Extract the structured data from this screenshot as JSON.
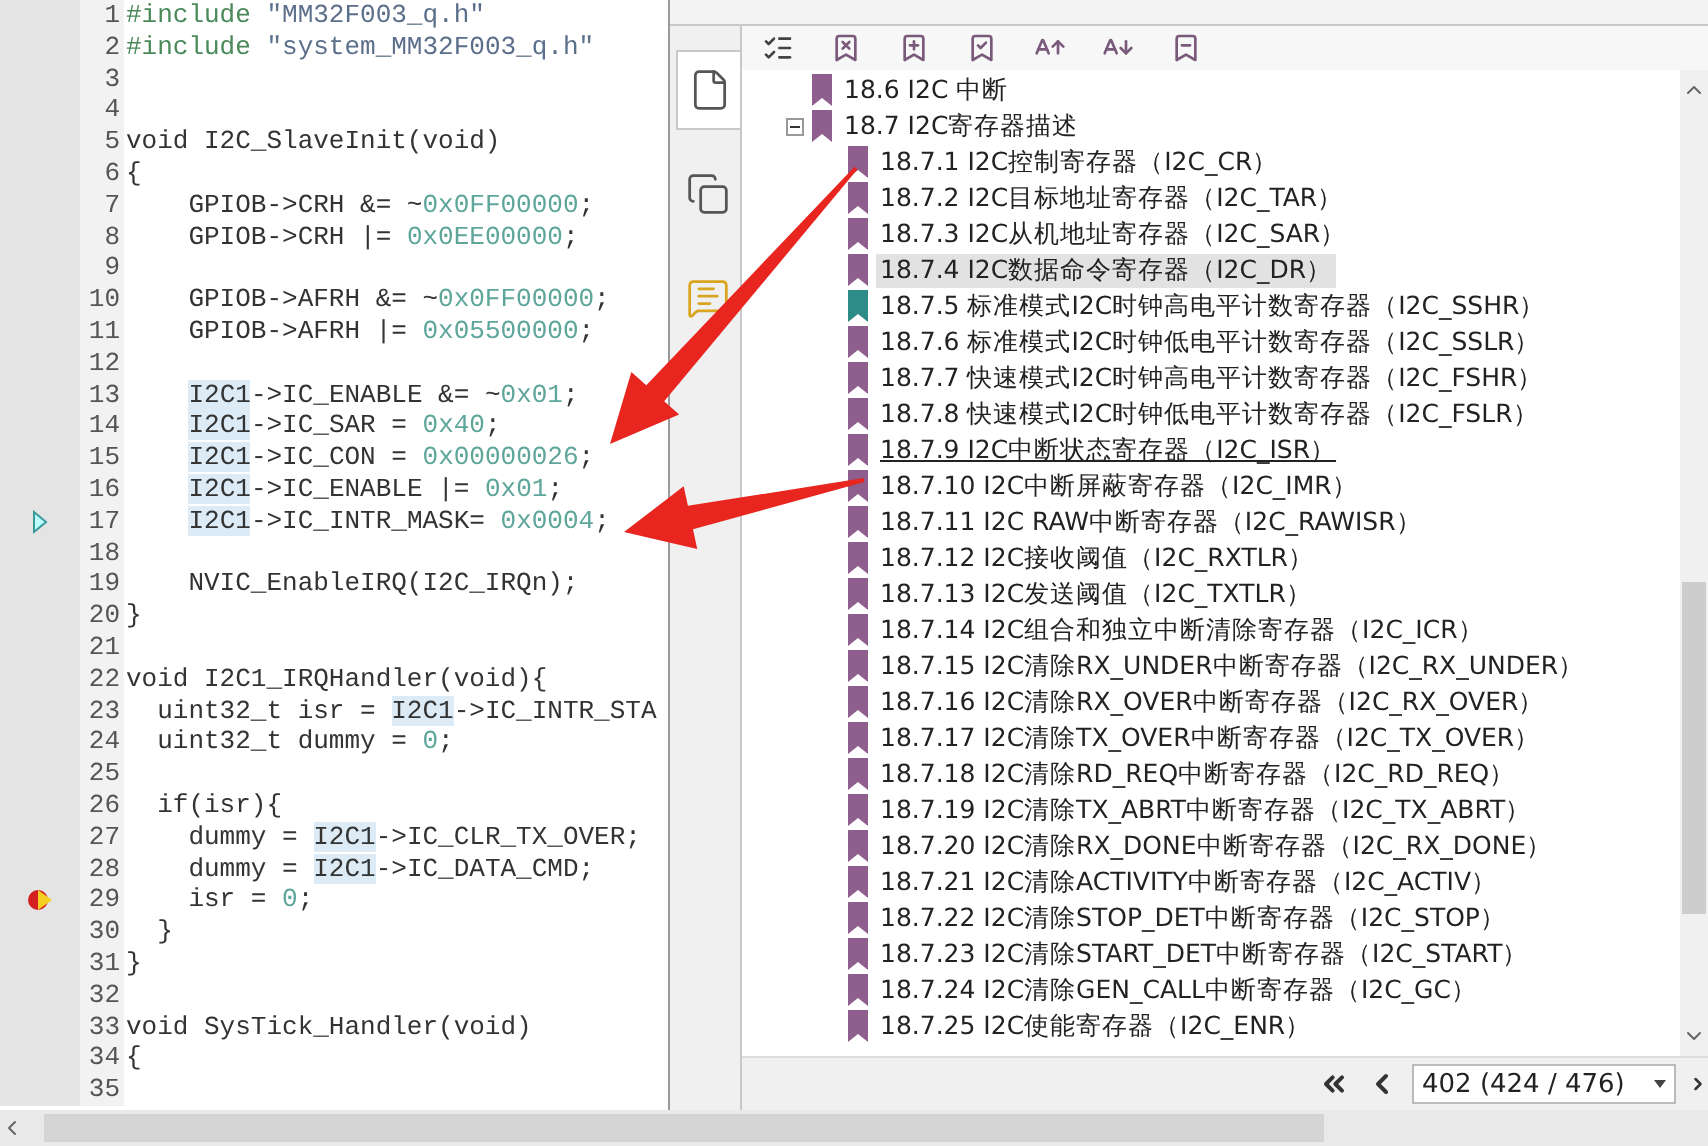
{
  "editor": {
    "lines": [
      {
        "number": "1",
        "current": false,
        "breakpoint": false,
        "segments": [
          {
            "kind": "pre",
            "text": "#include"
          },
          {
            "kind": "str",
            "text": " \"MM32F003_q.h\""
          }
        ]
      },
      {
        "number": "2",
        "current": false,
        "breakpoint": false,
        "segments": [
          {
            "kind": "pre",
            "text": "#include"
          },
          {
            "kind": "str",
            "text": " \"system_MM32F003_q.h\""
          }
        ]
      },
      {
        "number": "3",
        "current": false,
        "breakpoint": false
      },
      {
        "number": "4",
        "current": false,
        "breakpoint": false
      },
      {
        "number": "5",
        "current": false,
        "breakpoint": false,
        "segments": [
          {
            "kind": "text",
            "text": "void I2C_SlaveInit(void)"
          }
        ]
      },
      {
        "number": "6",
        "current": false,
        "breakpoint": false,
        "segments": [
          {
            "kind": "text",
            "text": "{"
          }
        ]
      },
      {
        "number": "7",
        "current": false,
        "breakpoint": false,
        "segments": [
          {
            "kind": "text",
            "text": "    GPIOB->CRH &= ~"
          },
          {
            "kind": "num",
            "text": "0x0FF00000"
          },
          {
            "kind": "text",
            "text": ";"
          }
        ]
      },
      {
        "number": "8",
        "current": false,
        "breakpoint": false,
        "segments": [
          {
            "kind": "text",
            "text": "    GPIOB->CRH |= "
          },
          {
            "kind": "num",
            "text": "0x0EE00000"
          },
          {
            "kind": "text",
            "text": ";"
          }
        ]
      },
      {
        "number": "9",
        "current": false,
        "breakpoint": false
      },
      {
        "number": "10",
        "current": false,
        "breakpoint": false,
        "segments": [
          {
            "kind": "text",
            "text": "    GPIOB->AFRH &= ~"
          },
          {
            "kind": "num",
            "text": "0x0FF00000"
          },
          {
            "kind": "text",
            "text": ";"
          }
        ]
      },
      {
        "number": "11",
        "current": false,
        "breakpoint": false,
        "segments": [
          {
            "kind": "text",
            "text": "    GPIOB->AFRH |= "
          },
          {
            "kind": "num",
            "text": "0x05500000"
          },
          {
            "kind": "text",
            "text": ";"
          }
        ]
      },
      {
        "number": "12",
        "current": false,
        "breakpoint": false
      },
      {
        "number": "13",
        "current": false,
        "breakpoint": false,
        "segments": [
          {
            "kind": "hl",
            "text": "    I2C1"
          },
          {
            "kind": "text",
            "text": "->IC_ENABLE &= ~"
          },
          {
            "kind": "num",
            "text": "0x01"
          },
          {
            "kind": "text",
            "text": ";"
          }
        ]
      },
      {
        "number": "14",
        "current": false,
        "breakpoint": false,
        "segments": [
          {
            "kind": "hl",
            "text": "    I2C1"
          },
          {
            "kind": "text",
            "text": "->IC_SAR = "
          },
          {
            "kind": "num",
            "text": "0x40"
          },
          {
            "kind": "text",
            "text": ";"
          }
        ]
      },
      {
        "number": "15",
        "current": false,
        "breakpoint": false,
        "segments": [
          {
            "kind": "hl",
            "text": "    I2C1"
          },
          {
            "kind": "text",
            "text": "->IC_CON = "
          },
          {
            "kind": "num",
            "text": "0x00000026"
          },
          {
            "kind": "text",
            "text": ";"
          }
        ]
      },
      {
        "number": "16",
        "current": false,
        "breakpoint": false,
        "segments": [
          {
            "kind": "hl",
            "text": "    I2C1"
          },
          {
            "kind": "text",
            "text": "->IC_ENABLE |= "
          },
          {
            "kind": "num",
            "text": "0x01"
          },
          {
            "kind": "text",
            "text": ";"
          }
        ]
      },
      {
        "number": "17",
        "current": true,
        "breakpoint": false,
        "segments": [
          {
            "kind": "hl",
            "text": "    I2C1"
          },
          {
            "kind": "text",
            "text": "->IC_INTR_MASK= "
          },
          {
            "kind": "num",
            "text": "0x0004"
          },
          {
            "kind": "text",
            "text": ";"
          }
        ]
      },
      {
        "number": "18",
        "current": false,
        "breakpoint": false
      },
      {
        "number": "19",
        "current": false,
        "breakpoint": false,
        "segments": [
          {
            "kind": "text",
            "text": "    NVIC_EnableIRQ(I2C_IRQn);"
          }
        ]
      },
      {
        "number": "20",
        "current": false,
        "breakpoint": false,
        "segments": [
          {
            "kind": "text",
            "text": "}"
          }
        ]
      },
      {
        "number": "21",
        "current": false,
        "breakpoint": false
      },
      {
        "number": "22",
        "current": false,
        "breakpoint": false,
        "segments": [
          {
            "kind": "text",
            "text": "void I2C1_IRQHandler(void){"
          }
        ]
      },
      {
        "number": "23",
        "current": false,
        "breakpoint": false,
        "segments": [
          {
            "kind": "text",
            "text": "  uint32_t isr = "
          },
          {
            "kind": "hl",
            "text": "I2C1"
          },
          {
            "kind": "text",
            "text": "->IC_INTR_STA"
          }
        ]
      },
      {
        "number": "24",
        "current": false,
        "breakpoint": false,
        "segments": [
          {
            "kind": "text",
            "text": "  uint32_t dummy = "
          },
          {
            "kind": "num",
            "text": "0"
          },
          {
            "kind": "text",
            "text": ";"
          }
        ]
      },
      {
        "number": "25",
        "current": false,
        "breakpoint": false
      },
      {
        "number": "26",
        "current": false,
        "breakpoint": false,
        "segments": [
          {
            "kind": "text",
            "text": "  if(isr){"
          }
        ]
      },
      {
        "number": "27",
        "current": false,
        "breakpoint": false,
        "segments": [
          {
            "kind": "text",
            "text": "    dummy = "
          },
          {
            "kind": "hl",
            "text": "I2C1"
          },
          {
            "kind": "text",
            "text": "->IC_CLR_TX_OVER;"
          }
        ]
      },
      {
        "number": "28",
        "current": false,
        "breakpoint": false,
        "segments": [
          {
            "kind": "text",
            "text": "    dummy = "
          },
          {
            "kind": "hl",
            "text": "I2C1"
          },
          {
            "kind": "text",
            "text": "->IC_DATA_CMD;"
          }
        ]
      },
      {
        "number": "29",
        "current": false,
        "breakpoint": true,
        "segments": [
          {
            "kind": "text",
            "text": "    isr = "
          },
          {
            "kind": "num",
            "text": "0"
          },
          {
            "kind": "text",
            "text": ";"
          }
        ]
      },
      {
        "number": "30",
        "current": false,
        "breakpoint": false,
        "segments": [
          {
            "kind": "text",
            "text": "  }"
          }
        ]
      },
      {
        "number": "31",
        "current": false,
        "breakpoint": false,
        "segments": [
          {
            "kind": "text",
            "text": "}"
          }
        ]
      },
      {
        "number": "32",
        "current": false,
        "breakpoint": false
      },
      {
        "number": "33",
        "current": false,
        "breakpoint": false,
        "segments": [
          {
            "kind": "text",
            "text": "void SysTick_Handler(void)"
          }
        ]
      },
      {
        "number": "34",
        "current": false,
        "breakpoint": false,
        "segments": [
          {
            "kind": "text",
            "text": "{"
          }
        ]
      },
      {
        "number": "35",
        "current": false,
        "breakpoint": false
      }
    ]
  },
  "bookmarks": {
    "side_tabs": [
      {
        "selected": true
      },
      {
        "selected": false
      },
      {
        "selected": false
      }
    ],
    "tree": [
      {
        "label": "18.6 I2C 中断",
        "expanded": false,
        "color": "#8e5f8e"
      },
      {
        "label": "18.7 I2C寄存器描述",
        "expanded": true,
        "color": "#8e5f8e",
        "children": [
          {
            "label": "18.7.1 I2C控制寄存器（I2C_CR）",
            "selected": false,
            "underlined": false,
            "color": "#8e5f8e"
          },
          {
            "label": "18.7.2 I2C目标地址寄存器（I2C_TAR）",
            "selected": false,
            "underlined": false,
            "color": "#8e5f8e"
          },
          {
            "label": "18.7.3 I2C从机地址寄存器（I2C_SAR）",
            "selected": false,
            "underlined": false,
            "color": "#8e5f8e"
          },
          {
            "label": "18.7.4 I2C数据命令寄存器（I2C_DR）",
            "selected": true,
            "underlined": false,
            "color": "#8e5f8e"
          },
          {
            "label": "18.7.5 标准模式I2C时钟高电平计数寄存器（I2C_SSHR）",
            "selected": false,
            "underlined": false,
            "color": "#2e8c88"
          },
          {
            "label": "18.7.6 标准模式I2C时钟低电平计数寄存器（I2C_SSLR）",
            "selected": false,
            "underlined": false,
            "color": "#8e5f8e"
          },
          {
            "label": "18.7.7 快速模式I2C时钟高电平计数寄存器（I2C_FSHR）",
            "selected": false,
            "underlined": false,
            "color": "#8e5f8e"
          },
          {
            "label": "18.7.8 快速模式I2C时钟低电平计数寄存器（I2C_FSLR）",
            "selected": false,
            "underlined": false,
            "color": "#8e5f8e"
          },
          {
            "label": "18.7.9 I2C中断状态寄存器（I2C_ISR）",
            "selected": false,
            "underlined": true,
            "color": "#8e5f8e"
          },
          {
            "label": "18.7.10 I2C中断屏蔽寄存器（I2C_IMR）",
            "selected": false,
            "underlined": false,
            "color": "#8e5f8e"
          },
          {
            "label": "18.7.11 I2C RAW中断寄存器（I2C_RAWISR）",
            "selected": false,
            "underlined": false,
            "color": "#8e5f8e"
          },
          {
            "label": "18.7.12 I2C接收阈值（I2C_RXTLR）",
            "selected": false,
            "underlined": false,
            "color": "#8e5f8e"
          },
          {
            "label": "18.7.13 I2C发送阈值（I2C_TXTLR）",
            "selected": false,
            "underlined": false,
            "color": "#8e5f8e"
          },
          {
            "label": "18.7.14 I2C组合和独立中断清除寄存器（I2C_ICR）",
            "selected": false,
            "underlined": false,
            "color": "#8e5f8e"
          },
          {
            "label": "18.7.15 I2C清除RX_UNDER中断寄存器（I2C_RX_UNDER）",
            "selected": false,
            "underlined": false,
            "color": "#8e5f8e"
          },
          {
            "label": "18.7.16 I2C清除RX_OVER中断寄存器（I2C_RX_OVER）",
            "selected": false,
            "underlined": false,
            "color": "#8e5f8e"
          },
          {
            "label": "18.7.17 I2C清除TX_OVER中断寄存器（I2C_TX_OVER）",
            "selected": false,
            "underlined": false,
            "color": "#8e5f8e"
          },
          {
            "label": "18.7.18 I2C清除RD_REQ中断寄存器（I2C_RD_REQ）",
            "selected": false,
            "underlined": false,
            "color": "#8e5f8e"
          },
          {
            "label": "18.7.19 I2C清除TX_ABRT中断寄存器（I2C_TX_ABRT）",
            "selected": false,
            "underlined": false,
            "color": "#8e5f8e"
          },
          {
            "label": "18.7.20 I2C清除RX_DONE中断寄存器（I2C_RX_DONE）",
            "selected": false,
            "underlined": false,
            "color": "#8e5f8e"
          },
          {
            "label": "18.7.21 I2C清除ACTIVITY中断寄存器（I2C_ACTIV）",
            "selected": false,
            "underlined": false,
            "color": "#8e5f8e"
          },
          {
            "label": "18.7.22 I2C清除STOP_DET中断寄存器（I2C_STOP）",
            "selected": false,
            "underlined": false,
            "color": "#8e5f8e"
          },
          {
            "label": "18.7.23 I2C清除START_DET中断寄存器（I2C_START）",
            "selected": false,
            "underlined": false,
            "color": "#8e5f8e"
          },
          {
            "label": "18.7.24 I2C清除GEN_CALL中断寄存器（I2C_GC）",
            "selected": false,
            "underlined": false,
            "color": "#8e5f8e"
          },
          {
            "label": "18.7.25 I2C使能寄存器（I2C_ENR）",
            "selected": false,
            "underlined": false,
            "color": "#8e5f8e"
          }
        ]
      }
    ],
    "page_field": {
      "value": "402 (424 / 476)"
    }
  }
}
